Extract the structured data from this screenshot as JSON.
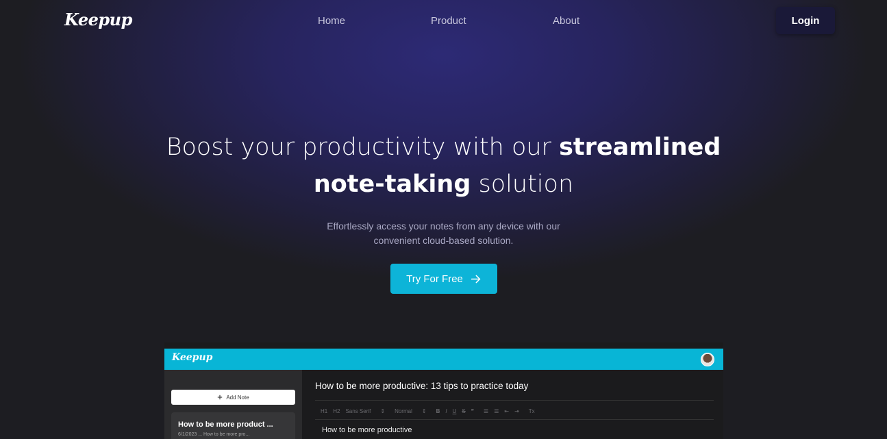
{
  "brand": {
    "name": "Keepup"
  },
  "nav": {
    "links": [
      "Home",
      "Product",
      "About"
    ],
    "login_label": "Login"
  },
  "hero": {
    "headline_pre": "Boost your productivity with our ",
    "headline_strong1": "streamlined",
    "headline_strong2": "note-taking",
    "headline_post": " solution",
    "subtext_line1": "Effortlessly access your notes from any device with our",
    "subtext_line2": "convenient cloud-based solution.",
    "cta_label": "Try For Free",
    "cta_icon": "arrow-right-icon"
  },
  "preview": {
    "brand": "Keepup",
    "add_note_label": "Add Note",
    "note_card": {
      "title": "How to be more product ...",
      "meta": "6/1/2023 ... How to be more pro..."
    },
    "editor": {
      "title": "How to be more productive: 13 tips to practice today",
      "toolbar": [
        "H1",
        "H2",
        "Sans Serif",
        "⇕",
        "Normal",
        "⇕",
        "B",
        "I",
        "U",
        "S",
        "❞",
        "☰",
        "☰",
        "⇤",
        "⇥",
        "Tx"
      ],
      "body": "How to be more productive"
    }
  },
  "colors": {
    "accent": "#0db4d8",
    "hero_glow": "#2d2a75",
    "login_bg": "#1a1938",
    "page_bg": "#1d1d22"
  }
}
